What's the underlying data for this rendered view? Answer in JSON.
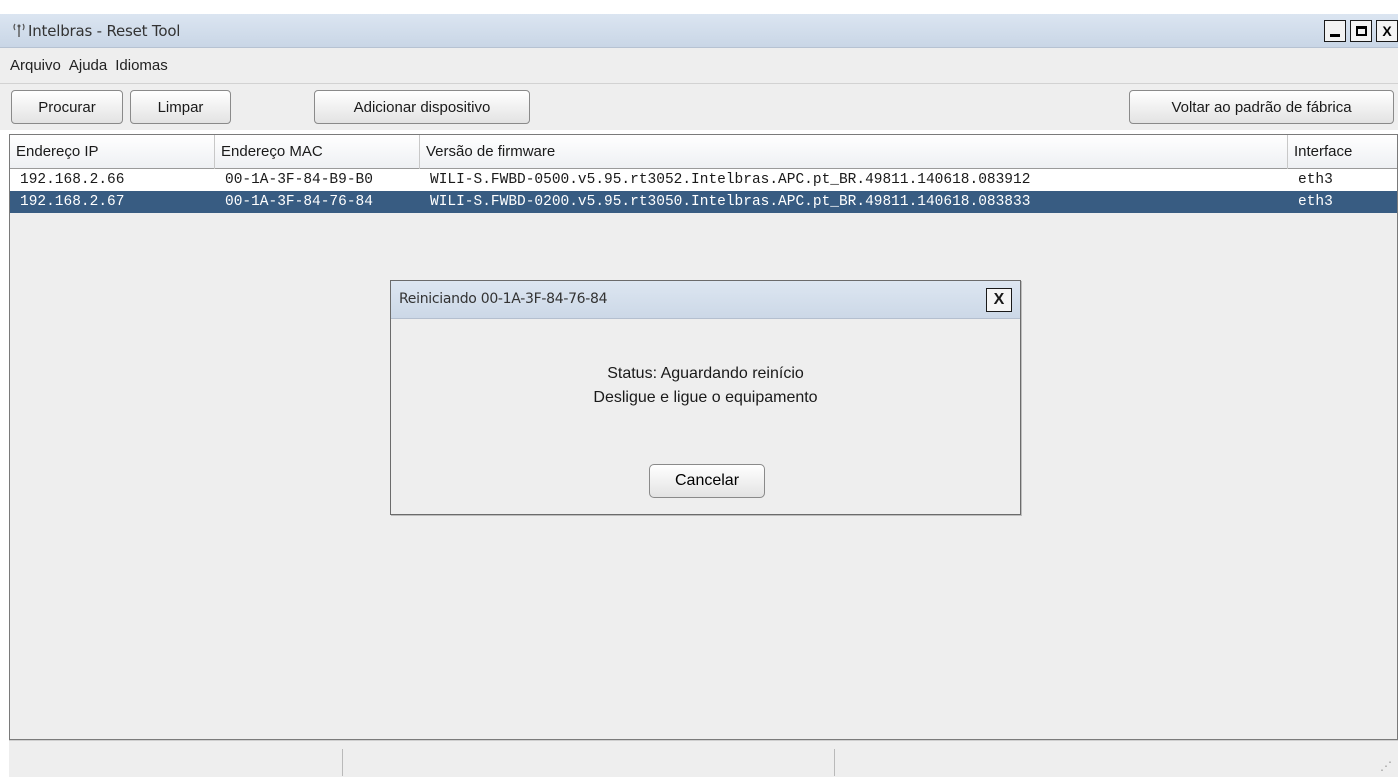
{
  "window": {
    "title": "Intelbras - Reset Tool",
    "app_icon": "antenna-icon",
    "minimize_label": "_",
    "close_label": "X"
  },
  "menu": [
    "Arquivo",
    "Ajuda",
    "Idiomas"
  ],
  "toolbar": {
    "search_label": "Procurar",
    "clear_label": "Limpar",
    "add_device_label": "Adicionar dispositivo",
    "factory_reset_label": "Voltar ao padrão de fábrica"
  },
  "table": {
    "columns": [
      "Endereço IP",
      "Endereço MAC",
      "Versão de firmware",
      "Interface"
    ],
    "rows": [
      {
        "ip": "192.168.2.66",
        "mac": "00-1A-3F-84-B9-B0",
        "firmware": "WILI-S.FWBD-0500.v5.95.rt3052.Intelbras.APC.pt_BR.49811.140618.083912",
        "interface": "eth3",
        "selected": false
      },
      {
        "ip": "192.168.2.67",
        "mac": "00-1A-3F-84-76-84",
        "firmware": "WILI-S.FWBD-0200.v5.95.rt3050.Intelbras.APC.pt_BR.49811.140618.083833",
        "interface": "eth3",
        "selected": true
      }
    ]
  },
  "dialog": {
    "title": "Reiniciando 00-1A-3F-84-76-84",
    "close_label": "X",
    "status_line": "Status: Aguardando reinício",
    "instruction_line": "Desligue e ligue o equipamento",
    "cancel_label": "Cancelar"
  },
  "colors": {
    "selection": "#385c82",
    "titlebar": "#d3deeb",
    "panel": "#eeeeee"
  }
}
